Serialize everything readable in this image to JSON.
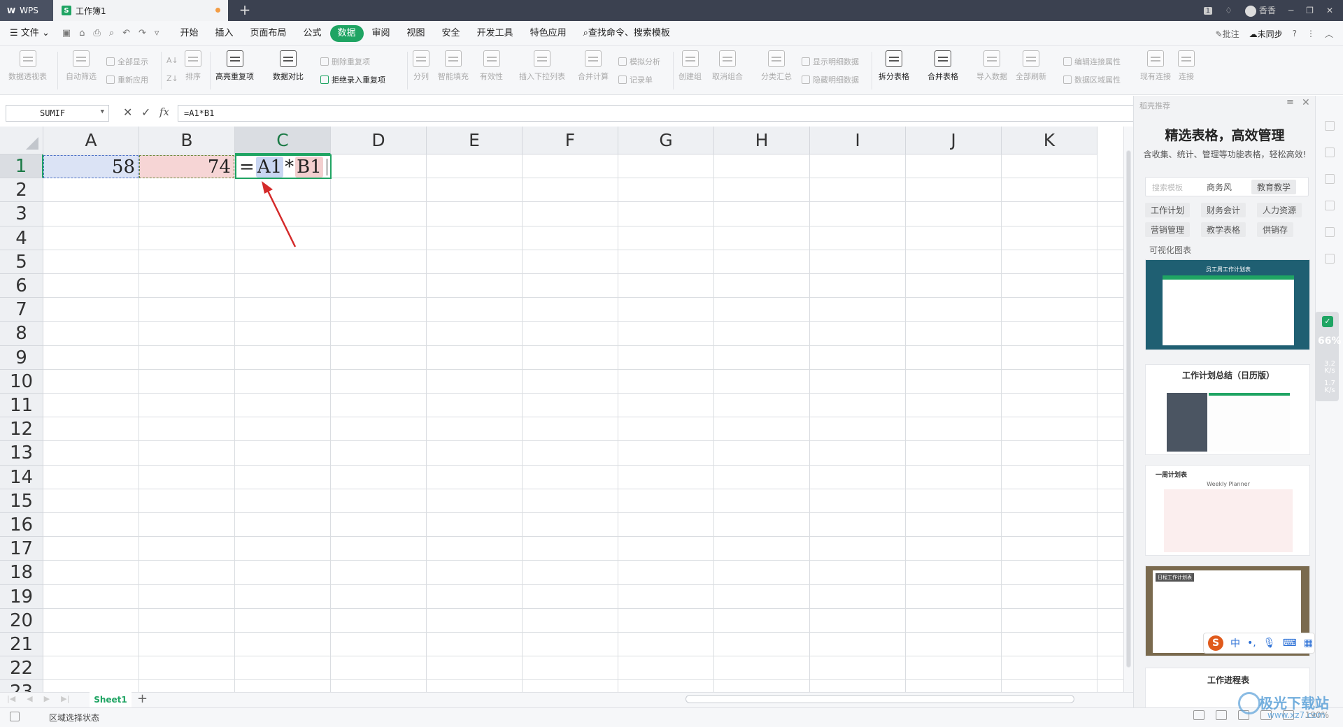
{
  "title_bar": {
    "wps_label": "WPS",
    "doc_tab": "工作簿1",
    "new_tab": "+",
    "badge_num": "1",
    "user": "香香",
    "min": "─",
    "max": "❐",
    "close": "✕"
  },
  "menu": {
    "file": "文件",
    "items": [
      "开始",
      "插入",
      "页面布局",
      "公式",
      "数据",
      "审阅",
      "视图",
      "安全",
      "开发工具",
      "特色应用"
    ],
    "active": "数据",
    "search": "查找命令、搜索模板",
    "right": {
      "comment": "批注",
      "sync": "未同步",
      "help": "?"
    }
  },
  "ribbon": {
    "pivot": "数据透视表",
    "autofilter": "自动筛选",
    "show_all": "全部显示",
    "reapply": "重新应用",
    "sort": "排序",
    "highlight_dup": "高亮重复项",
    "data_compare": "数据对比",
    "remove_dup": "删除重复项",
    "reject_dup": "拒绝录入重复项",
    "split": "分列",
    "fill": "智能填充",
    "validity": "有效性",
    "dropdown": "插入下拉列表",
    "consolidate": "合并计算",
    "simulate": "模拟分析",
    "record": "记录单",
    "group": "创建组",
    "ungroup": "取消组合",
    "subtotal": "分类汇总",
    "show_detail": "显示明细数据",
    "hide_detail": "隐藏明细数据",
    "split_table": "拆分表格",
    "merge_table": "合并表格",
    "import": "导入数据",
    "refresh_all": "全部刷新",
    "edit_conn": "编辑连接属性",
    "range_props": "数据区域属性",
    "existing_conn": "现有连接",
    "connect": "连接"
  },
  "formula_bar": {
    "name_box": "SUMIF",
    "cancel": "✕",
    "confirm": "✓",
    "fx": "fx",
    "formula": "=A1*B1"
  },
  "grid": {
    "columns": [
      "A",
      "B",
      "C",
      "D",
      "E",
      "F",
      "G",
      "H",
      "I",
      "J",
      "K"
    ],
    "selected_column": "C",
    "rows": [
      "1",
      "2",
      "3",
      "4",
      "5",
      "6",
      "7",
      "8",
      "9",
      "10",
      "11",
      "12",
      "13",
      "14",
      "15",
      "16",
      "17",
      "18",
      "19",
      "20",
      "21",
      "22",
      "23"
    ],
    "selected_row": "1",
    "cells": {
      "A1": "58",
      "B1": "74"
    },
    "editing": {
      "eq": "=",
      "ref1": "A1",
      "op": "*",
      "ref2": "B1"
    }
  },
  "sheets": {
    "tab": "Sheet1",
    "add": "+"
  },
  "status": {
    "text": "区域选择状态",
    "zoom": "190%"
  },
  "panel": {
    "header": "稻壳推荐",
    "title": "精选表格，高效管理",
    "subtitle": "含收集、统计、管理等功能表格，轻松高效!",
    "search_placeholder": "搜索模板",
    "tags_row1": [
      "商务风",
      "教育教学"
    ],
    "tags_row2": [
      "工作计划",
      "财务会计",
      "人力资源"
    ],
    "tags_row3": [
      "营销管理",
      "教学表格",
      "供销存"
    ],
    "visual": "可视化图表",
    "templates": [
      "员工周工作计划表",
      "工作计划总结（日历版）",
      "一周计划表",
      "日程工作计划表",
      "工作进程表"
    ],
    "weekly_planner": "Weekly   Planner"
  },
  "speed_widget": {
    "percent": "66%",
    "up": "3.2 K/s",
    "down": "1.7 K/s"
  },
  "ime": {
    "mode": "中",
    "punct": "•,"
  },
  "watermark": {
    "site": "极光下载站",
    "url": "www.xz7.com"
  },
  "colors": {
    "accent": "#1fa463",
    "title_bg": "#3b4150",
    "ref_a": "#c9d6f2",
    "ref_b": "#f3cfcf",
    "arrow": "#d42a2a"
  }
}
